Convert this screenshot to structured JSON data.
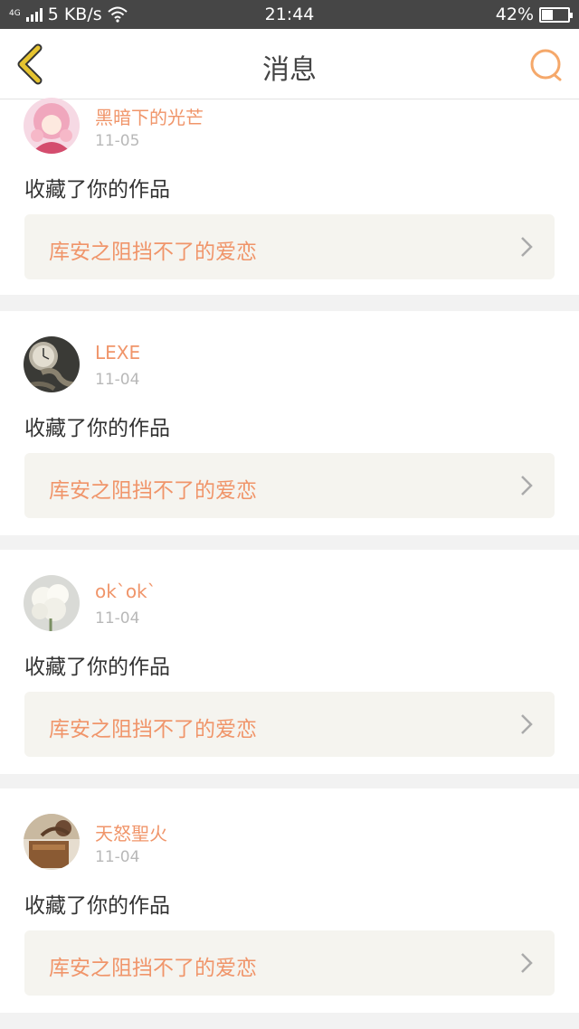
{
  "status_bar": {
    "network_tag": "4G",
    "speed": "5 KB/s",
    "time": "21:44",
    "battery_text": "42%",
    "battery_level": 0.42
  },
  "nav": {
    "title": "消息",
    "accent_color": "#f5a86a",
    "back_color": "#e6c430"
  },
  "messages": [
    {
      "username": "黑暗下的光芒",
      "date": "11-05",
      "action": "收藏了你的作品",
      "work_title": "库安之阻挡不了的爱恋",
      "avatar": "anime-girl-avatar"
    },
    {
      "username": "LEXE",
      "date": "11-04",
      "action": "收藏了你的作品",
      "work_title": "库安之阻挡不了的爱恋",
      "avatar": "pocket-watch-avatar"
    },
    {
      "username": "ok`ok`",
      "date": "11-04",
      "action": "收藏了你的作品",
      "work_title": "库安之阻挡不了的爱恋",
      "avatar": "white-flowers-avatar"
    },
    {
      "username": "天怒聖火",
      "date": "11-04",
      "action": "收藏了你的作品",
      "work_title": "库安之阻挡不了的爱恋",
      "avatar": "room-photo-avatar"
    }
  ]
}
